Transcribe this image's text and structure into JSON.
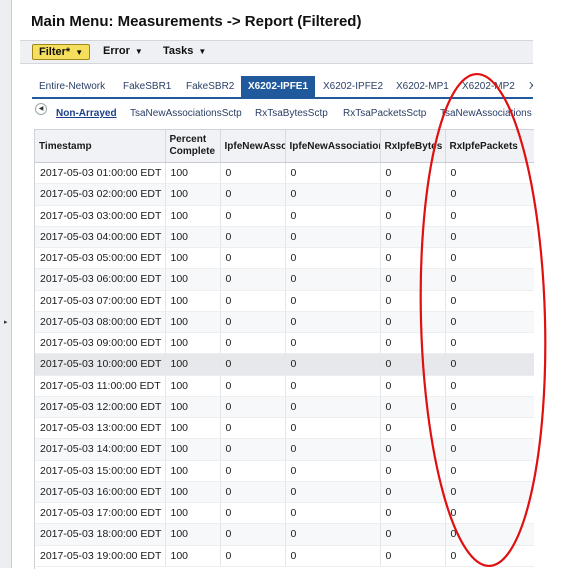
{
  "page": {
    "title": "Main Menu: Measurements -> Report (Filtered)"
  },
  "toolbar": {
    "filter_label": "Filter*",
    "error_label": "Error",
    "tasks_label": "Tasks"
  },
  "tabs": [
    {
      "label": "Entire-Network",
      "active": false
    },
    {
      "label": "FakeSBR1",
      "active": false
    },
    {
      "label": "FakeSBR2",
      "active": false
    },
    {
      "label": "X6202-IPFE1",
      "active": true
    },
    {
      "label": "X6202-IPFE2",
      "active": false
    },
    {
      "label": "X6202-MP1",
      "active": false
    },
    {
      "label": "X6202-MP2",
      "active": false
    },
    {
      "label": "X",
      "active": false
    }
  ],
  "subtabs": [
    {
      "label": "Non-Arrayed",
      "active": true
    },
    {
      "label": "TsaNewAssociationsSctp",
      "active": false
    },
    {
      "label": "RxTsaBytesSctp",
      "active": false
    },
    {
      "label": "RxTsaPacketsSctp",
      "active": false
    },
    {
      "label": "TsaNewAssociations",
      "active": false
    }
  ],
  "table": {
    "columns": [
      "Timestamp",
      "Percent Complete",
      "IpfeNewAssoc",
      "IpfeNewAssociation",
      "RxIpfeBytes",
      "RxIpfePackets"
    ],
    "rows": [
      [
        "2017-05-03 01:00:00 EDT",
        "100",
        "0",
        "0",
        "0",
        "0"
      ],
      [
        "2017-05-03 02:00:00 EDT",
        "100",
        "0",
        "0",
        "0",
        "0"
      ],
      [
        "2017-05-03 03:00:00 EDT",
        "100",
        "0",
        "0",
        "0",
        "0"
      ],
      [
        "2017-05-03 04:00:00 EDT",
        "100",
        "0",
        "0",
        "0",
        "0"
      ],
      [
        "2017-05-03 05:00:00 EDT",
        "100",
        "0",
        "0",
        "0",
        "0"
      ],
      [
        "2017-05-03 06:00:00 EDT",
        "100",
        "0",
        "0",
        "0",
        "0"
      ],
      [
        "2017-05-03 07:00:00 EDT",
        "100",
        "0",
        "0",
        "0",
        "0"
      ],
      [
        "2017-05-03 08:00:00 EDT",
        "100",
        "0",
        "0",
        "0",
        "0"
      ],
      [
        "2017-05-03 09:00:00 EDT",
        "100",
        "0",
        "0",
        "0",
        "0"
      ],
      [
        "2017-05-03 10:00:00 EDT",
        "100",
        "0",
        "0",
        "0",
        "0"
      ],
      [
        "2017-05-03 11:00:00 EDT",
        "100",
        "0",
        "0",
        "0",
        "0"
      ],
      [
        "2017-05-03 12:00:00 EDT",
        "100",
        "0",
        "0",
        "0",
        "0"
      ],
      [
        "2017-05-03 13:00:00 EDT",
        "100",
        "0",
        "0",
        "0",
        "0"
      ],
      [
        "2017-05-03 14:00:00 EDT",
        "100",
        "0",
        "0",
        "0",
        "0"
      ],
      [
        "2017-05-03 15:00:00 EDT",
        "100",
        "0",
        "0",
        "0",
        "0"
      ],
      [
        "2017-05-03 16:00:00 EDT",
        "100",
        "0",
        "0",
        "0",
        "0"
      ],
      [
        "2017-05-03 17:00:00 EDT",
        "100",
        "0",
        "0",
        "0",
        "0"
      ],
      [
        "2017-05-03 18:00:00 EDT",
        "100",
        "0",
        "0",
        "0",
        "0"
      ],
      [
        "2017-05-03 19:00:00 EDT",
        "100",
        "0",
        "0",
        "0",
        "0"
      ]
    ],
    "highlighted_row": 9
  },
  "colors": {
    "accent": "#215a9c",
    "filter_button": "#f7df5e",
    "annotation": "#e01010"
  }
}
